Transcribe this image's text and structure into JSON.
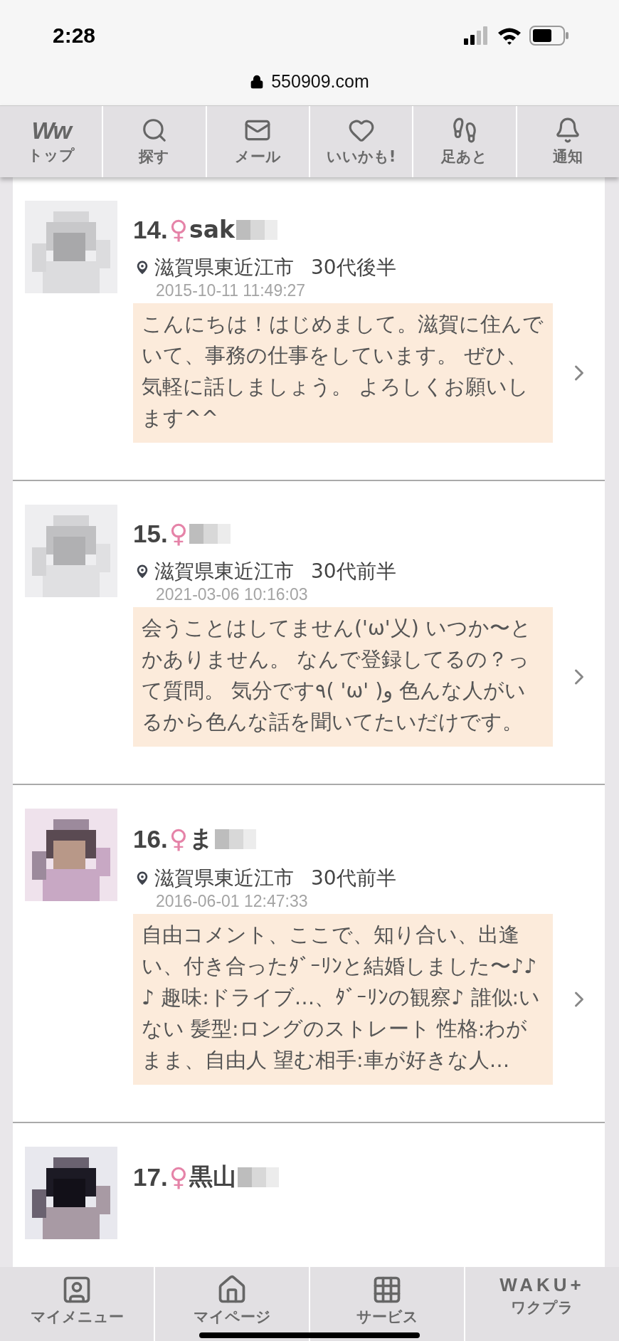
{
  "status_bar": {
    "time": "2:28",
    "url": "550909.com"
  },
  "top_nav": [
    {
      "kind": "logo",
      "logo": "Ww",
      "label": "トップ"
    },
    {
      "kind": "search",
      "label": "探す"
    },
    {
      "kind": "mail",
      "label": "メール"
    },
    {
      "kind": "heart",
      "label": "いいかも!"
    },
    {
      "kind": "footprints",
      "label": "足あと"
    },
    {
      "kind": "bell",
      "label": "通知"
    }
  ],
  "profiles": [
    {
      "number": "14.",
      "gender": "♀",
      "name": "sak",
      "location": "滋賀県東近江市",
      "age": "30代後半",
      "date": "2015-10-11 11:49:27",
      "comment": "こんにちは！はじめまして。滋賀に住んでいて、事務の仕事をしています。 ぜひ、気軽に話しましょう。 よろしくお願いします^^"
    },
    {
      "number": "15.",
      "gender": "♀",
      "location": "滋賀県東近江市",
      "age": "30代前半",
      "date": "2021-03-06 10:16:03",
      "comment": "会うことはしてません('ω'乂) いつか〜とかありません。 なんで登録してるの？って質問。 気分です٩( 'ω' )و 色んな人がいるから色んな話を聞いてたいだけです。"
    },
    {
      "number": "16.",
      "gender": "♀",
      "name": "ま",
      "location": "滋賀県東近江市",
      "age": "30代前半",
      "date": "2016-06-01 12:47:33",
      "comment": "自由コメント、ここで、知り合い、出逢い、付き合ったﾀﾞｰﾘﾝと結婚しました〜♪♪♪ 趣味:ドライブ…、ﾀﾞｰﾘﾝの観察♪ 誰似:いない 髪型:ロングのストレート 性格:わがまま、自由人 望む相手:車が好きな人…"
    },
    {
      "number": "17.",
      "gender": "♀",
      "name": "黒山"
    }
  ],
  "bottom_nav": [
    {
      "kind": "user",
      "label": "マイメニュー"
    },
    {
      "kind": "home",
      "label": "マイページ"
    },
    {
      "kind": "grid",
      "label": "サービス"
    },
    {
      "kind": "logo",
      "logo": "WAKU+",
      "label": "ワクプラ"
    }
  ]
}
